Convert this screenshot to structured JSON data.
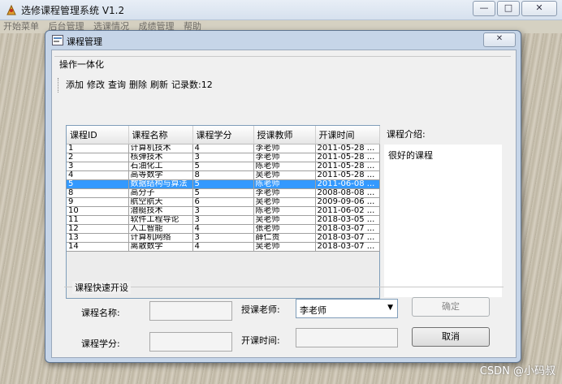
{
  "app": {
    "title": "选修课程管理系统 V1.2",
    "menu": [
      "开始菜单",
      "后台管理",
      "选课情况",
      "成绩管理",
      "帮助"
    ],
    "window_buttons": {
      "minimize": "—",
      "maximize": "□",
      "close": "✕"
    }
  },
  "dialog": {
    "title": "课程管理",
    "close": "✕"
  },
  "ops": {
    "group_title": "操作一体化",
    "toolbar": [
      "添加",
      "修改",
      "查询",
      "删除",
      "刷新"
    ],
    "record_count": "记录数:12"
  },
  "table": {
    "headers": [
      "课程ID",
      "课程名称",
      "课程学分",
      "授课教师",
      "开课时间"
    ],
    "selected_row_id": "5",
    "rows": [
      {
        "id": "1",
        "name": "计算机技术",
        "credit": "4",
        "teacher": "李老师",
        "date": "2011-05-28 ..."
      },
      {
        "id": "2",
        "name": "核弹技术",
        "credit": "3",
        "teacher": "李老师",
        "date": "2011-05-28 ..."
      },
      {
        "id": "3",
        "name": "石油化工",
        "credit": "5",
        "teacher": "陈老师",
        "date": "2011-05-28 ..."
      },
      {
        "id": "4",
        "name": "高等数学",
        "credit": "8",
        "teacher": "吴老师",
        "date": "2011-05-28 ..."
      },
      {
        "id": "5",
        "name": "数据结构与算法",
        "credit": "5",
        "teacher": "陈老师",
        "date": "2011-06-08 ..."
      },
      {
        "id": "8",
        "name": "高分子",
        "credit": "5",
        "teacher": "李老师",
        "date": "2008-08-08 ..."
      },
      {
        "id": "9",
        "name": "航空航天",
        "credit": "6",
        "teacher": "吴老师",
        "date": "2009-09-06 ..."
      },
      {
        "id": "10",
        "name": "潜艇技术",
        "credit": "3",
        "teacher": "陈老师",
        "date": "2011-06-02 ..."
      },
      {
        "id": "11",
        "name": "软件工程导论",
        "credit": "3",
        "teacher": "吴老师",
        "date": "2018-03-05 ..."
      },
      {
        "id": "12",
        "name": "人工智能",
        "credit": "4",
        "teacher": "张老师",
        "date": "2018-03-07 ..."
      },
      {
        "id": "13",
        "name": "计算机网络",
        "credit": "3",
        "teacher": "薛仁贵",
        "date": "2018-03-07 ..."
      },
      {
        "id": "14",
        "name": "离散数学",
        "credit": "4",
        "teacher": "吴老师",
        "date": "2018-03-07 ..."
      }
    ]
  },
  "intro": {
    "label": "课程介绍:",
    "text": "很好的课程"
  },
  "quick": {
    "group_title": "课程快速开设",
    "name_label": "课程名称:",
    "credit_label": "课程学分:",
    "teacher_label": "授课老师:",
    "teacher_value": "李老师",
    "time_label": "开课时间:",
    "confirm": "确定",
    "cancel": "取消"
  },
  "watermark": "CSDN @小码叔",
  "colors": {
    "selection": "#3399ff",
    "dialog_frame": "#c6d5e8"
  }
}
